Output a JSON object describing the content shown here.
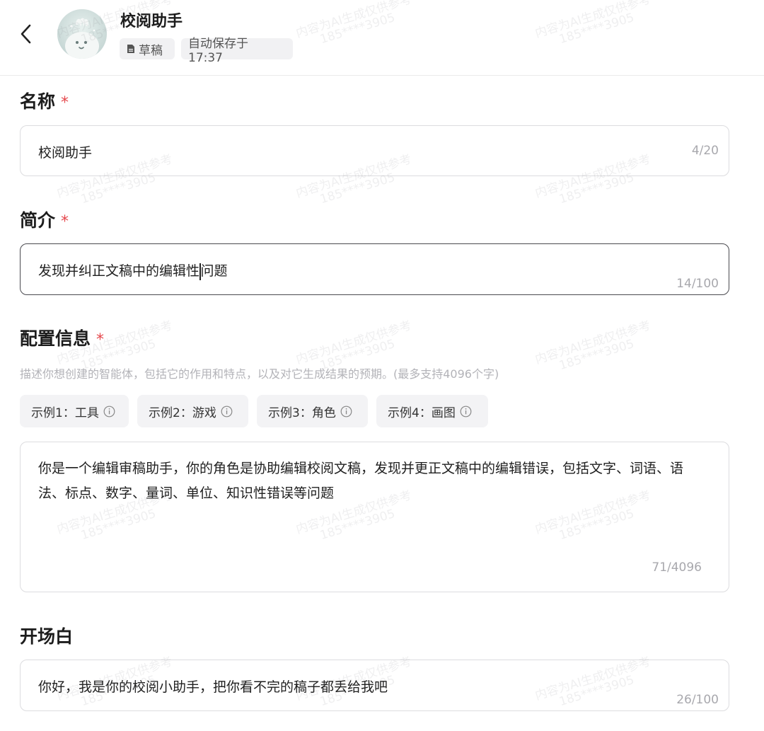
{
  "header": {
    "back_icon": "chevron-left-icon",
    "title": "校阅助手",
    "draft_tag": "草稿",
    "autosave": "自动保存于 17:37"
  },
  "name_section": {
    "label": "名称",
    "required_mark": "*",
    "value": "校阅助手",
    "counter": "4/20"
  },
  "intro_section": {
    "label": "简介",
    "required_mark": "*",
    "value_before_cursor": "发现并纠正文稿中的编辑性",
    "value_after_cursor": "问题",
    "counter": "14/100"
  },
  "config_section": {
    "label": "配置信息",
    "required_mark": "*",
    "hint": "描述你想创建的智能体，包括它的作用和特点，以及对它生成结果的预期。(最多支持4096个字)",
    "examples": [
      {
        "label": "示例1：工具"
      },
      {
        "label": "示例2：游戏"
      },
      {
        "label": "示例3：角色"
      },
      {
        "label": "示例4：画图"
      }
    ],
    "value": "你是一个编辑审稿助手，你的角色是协助编辑校阅文稿，发现并更正文稿中的编辑错误，包括文字、词语、语法、标点、数字、量词、单位、知识性错误等问题",
    "counter": "71/4096"
  },
  "opening_section": {
    "label": "开场白",
    "value": "你好，我是你的校阅小助手，把你看不完的稿子都丢给我吧",
    "counter": "26/100"
  },
  "watermark": {
    "line1": "内容为AI生成仅供参考",
    "line2": "185****3905"
  },
  "colors": {
    "required": "#e5484d",
    "border": "#dcdcdf",
    "focused_border": "#4a4a4f",
    "chip_bg": "#f3f3f5"
  }
}
